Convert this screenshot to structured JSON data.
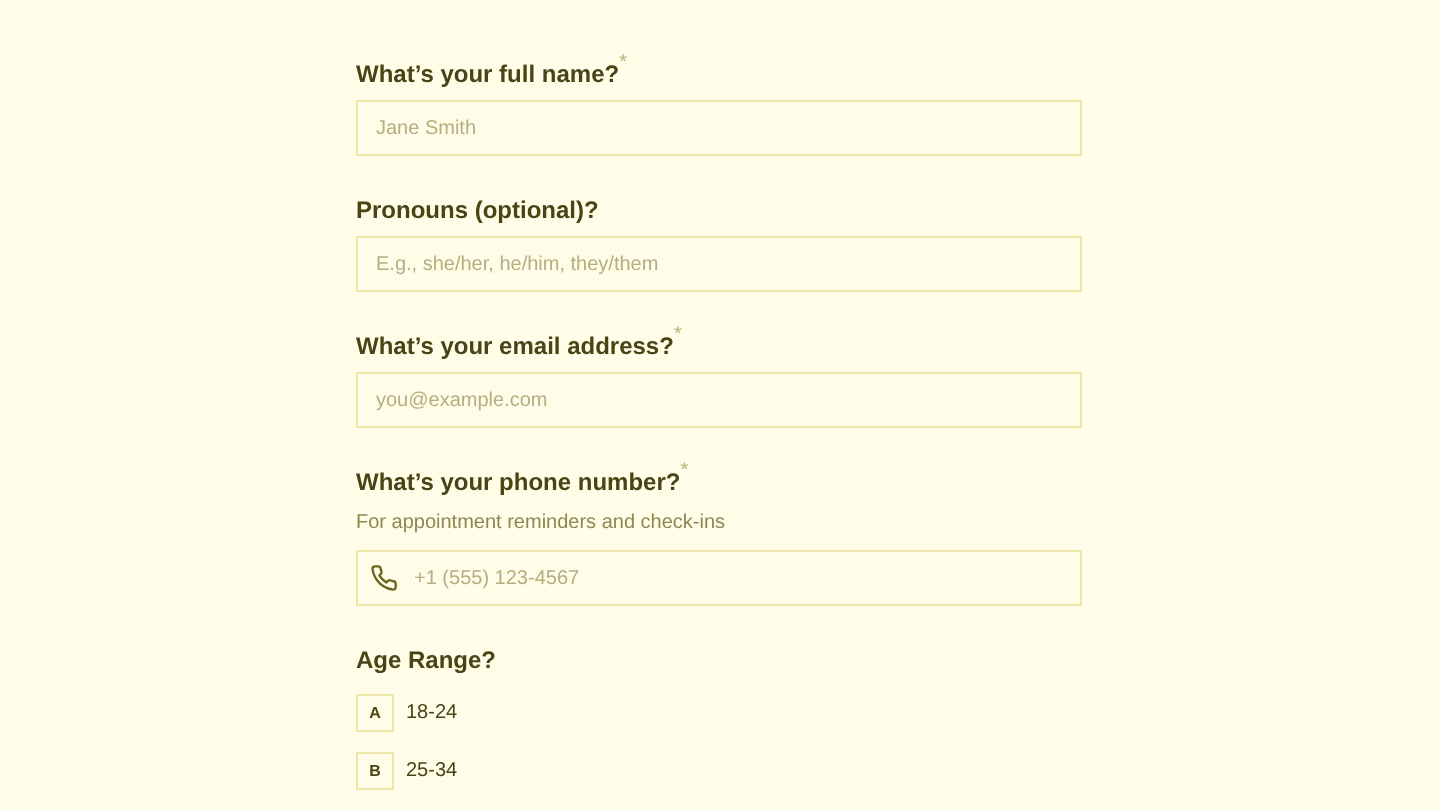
{
  "questions": [
    {
      "kind": "text",
      "label": "What’s your full name?",
      "required_mark": "*",
      "placeholder": "Jane Smith"
    },
    {
      "kind": "text",
      "label": "Pronouns (optional)?",
      "placeholder": "E.g., she/her, he/him, they/them"
    },
    {
      "kind": "text",
      "label": "What’s your email address?",
      "required_mark": "*",
      "placeholder": "you@example.com"
    },
    {
      "kind": "phone",
      "label": "What’s your phone number?",
      "required_mark": "*",
      "hint": "For appointment reminders and check-ins",
      "placeholder": "+1 (555) 123-4567"
    },
    {
      "kind": "choice",
      "label": "Age Range?",
      "options": [
        {
          "key": "A",
          "label": "18-24"
        },
        {
          "key": "B",
          "label": "25-34"
        }
      ]
    }
  ]
}
